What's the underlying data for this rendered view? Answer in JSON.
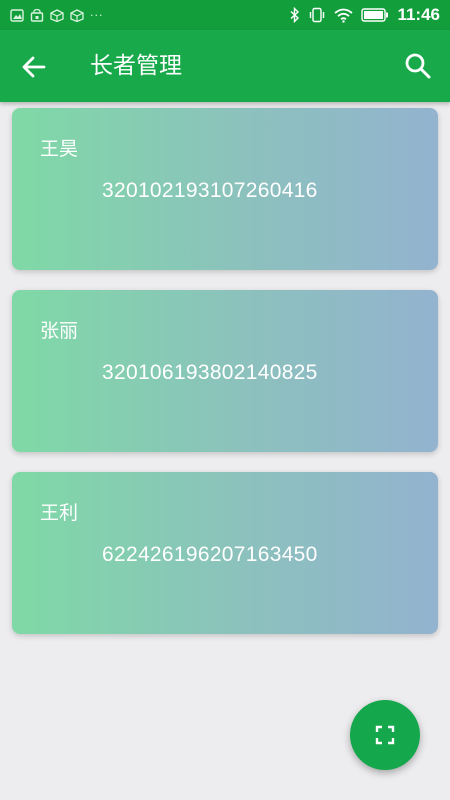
{
  "status_bar": {
    "time": "11:46",
    "notification_overflow": "···",
    "icons": [
      "image-icon",
      "lock-bag-icon",
      "package-icon",
      "package-icon",
      "bluetooth-icon",
      "vibrate-icon",
      "wifi-icon",
      "battery-icon"
    ]
  },
  "app_bar": {
    "title": "长者管理",
    "back_icon": "arrow-left-icon",
    "search_icon": "search-icon"
  },
  "elders": [
    {
      "name": "王昊",
      "id_number": "320102193107260416"
    },
    {
      "name": "张丽",
      "id_number": "320106193802140825"
    },
    {
      "name": "王利",
      "id_number": "622426196207163450"
    }
  ],
  "fab": {
    "icon": "scan-frame-icon"
  },
  "colors": {
    "primary": "#17a94a",
    "status_bar": "#139e3c",
    "card_gradient_start": "#7fd9a6",
    "card_gradient_end": "#93b3cf",
    "background": "#ededef"
  }
}
